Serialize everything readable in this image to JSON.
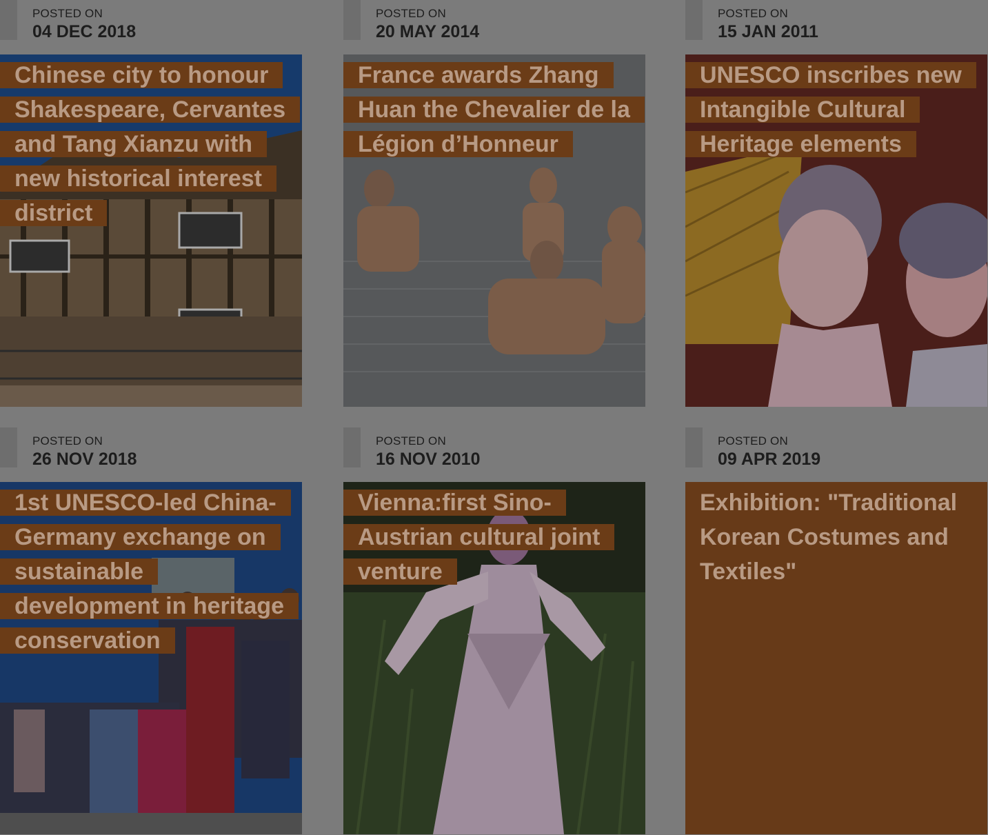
{
  "posts": [
    {
      "posted_label": "POSTED ON",
      "date": "04 DEC 2018",
      "title": "Chinese city to honour Shakespeare, Cervantes and Tang Xianzu with new historical interest district",
      "image": "tudor-house-photo"
    },
    {
      "posted_label": "POSTED ON",
      "date": "20 MAY 2014",
      "title": "France awards Zhang Huan the Chevalier de la Légion d’Honneur",
      "image": "people-in-water-photo"
    },
    {
      "posted_label": "POSTED ON",
      "date": "15 JAN 2011",
      "title": "UNESCO inscribes new Intangible Cultural Heritage elements",
      "image": "opera-performers-photo"
    },
    {
      "posted_label": "POSTED ON",
      "date": "26 NOV 2018",
      "title": "1st UNESCO-led China-Germany exchange on sustainable development in heritage conservation",
      "image": "group-photo"
    },
    {
      "posted_label": "POSTED ON",
      "date": "16 NOV 2010",
      "title": "Vienna:first Sino-Austrian cultural joint venture",
      "image": "costumed-dancer-photo"
    },
    {
      "posted_label": "POSTED ON",
      "date": "09 APR 2019",
      "title": "Exhibition: \"Traditional Korean Costumes and Textiles\"",
      "image": ""
    }
  ],
  "colors": {
    "overlay": "#7b7b7b",
    "title_bg": "#6b3c17",
    "title_text": "#b89a84",
    "date_text": "#1d1d1d"
  }
}
